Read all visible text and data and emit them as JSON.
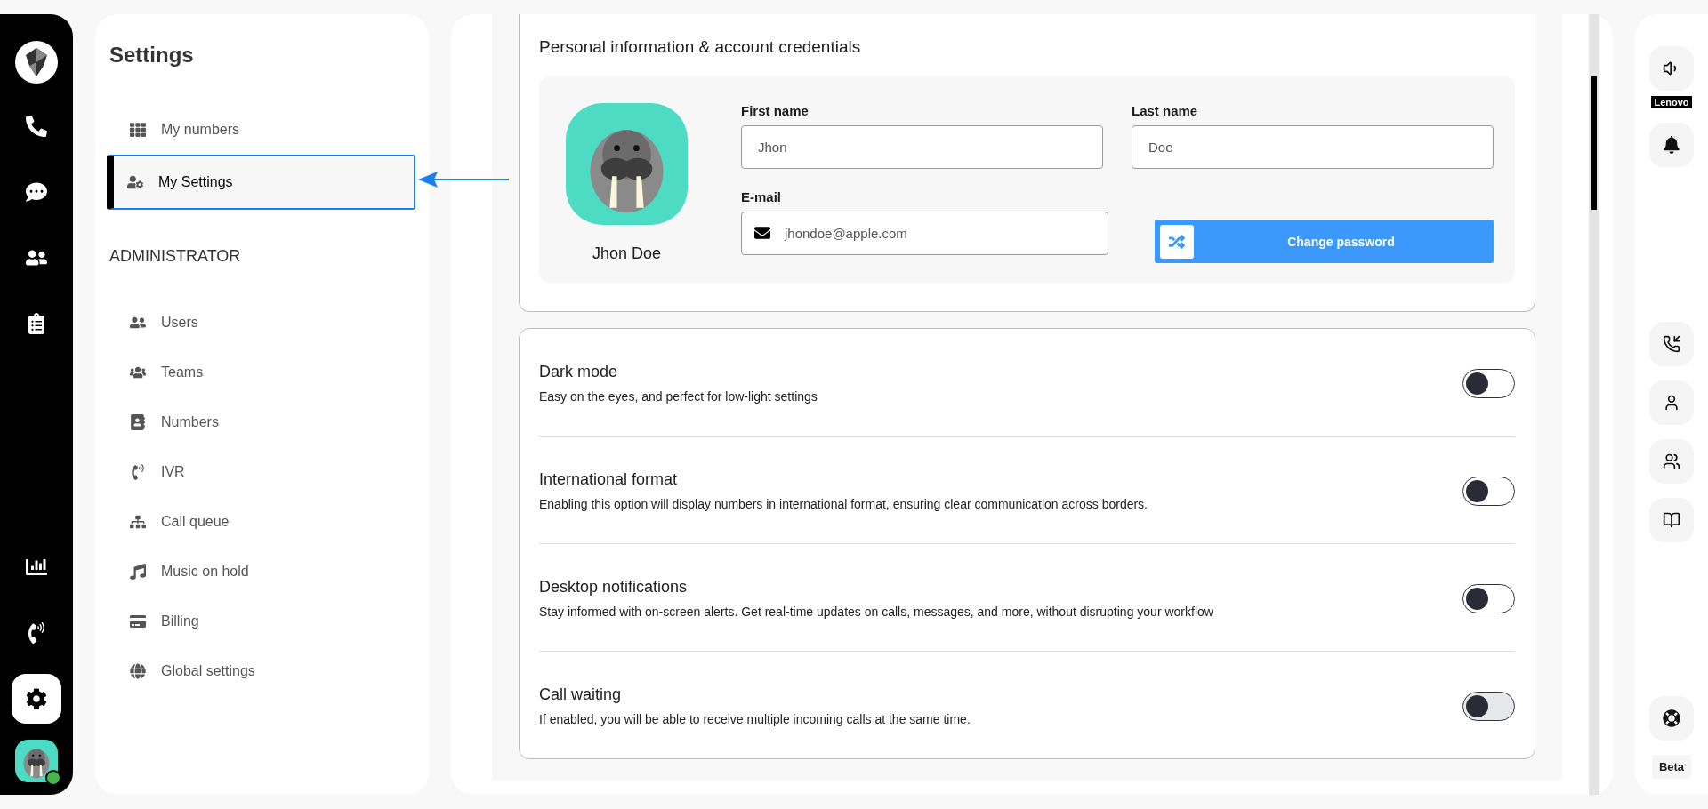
{
  "nav_rail": {
    "items": [
      {
        "selected": false
      },
      {
        "selected": false
      },
      {
        "selected": false
      },
      {
        "selected": false
      },
      {
        "selected": false
      },
      {
        "selected": false
      },
      {
        "selected": true
      }
    ]
  },
  "settings_panel": {
    "title": "Settings",
    "items": [
      {
        "label": "My numbers",
        "selected": false
      },
      {
        "label": "My Settings",
        "selected": true
      }
    ],
    "section": "ADMINISTRATOR",
    "admin_items": [
      {
        "label": "Users",
        "selected": false
      },
      {
        "label": "Teams",
        "selected": false
      },
      {
        "label": "Numbers",
        "selected": false
      },
      {
        "label": "IVR",
        "selected": false
      },
      {
        "label": "Call queue",
        "selected": false
      },
      {
        "label": "Music on hold",
        "selected": false
      },
      {
        "label": "Billing",
        "selected": false
      },
      {
        "label": "Global settings",
        "selected": false
      }
    ]
  },
  "profile": {
    "title": "Personal information & account credentials",
    "name": "Jhon Doe",
    "fields": [
      {
        "label": "First name",
        "value": "Jhon"
      },
      {
        "label": "Last name",
        "value": "Doe"
      },
      {
        "label": "E-mail",
        "value": "jhondoe@apple.com"
      }
    ],
    "button": "Change password"
  },
  "preferences": [
    {
      "title": "Dark mode",
      "description": "Easy on the eyes, and perfect for low-light settings",
      "on": false,
      "disabled": false
    },
    {
      "title": "International format",
      "description": "Enabling this option will display numbers in international format, ensuring clear communication across borders.",
      "on": false,
      "disabled": false
    },
    {
      "title": "Desktop notifications",
      "description": "Stay informed with on-screen alerts. Get real-time updates on calls, messages, and more, without disrupting your workflow",
      "on": false,
      "disabled": false
    },
    {
      "title": "Call waiting",
      "description": "If enabled, you will be able to receive multiple incoming calls at the same time.",
      "on": false,
      "disabled": true
    }
  ],
  "right_rail": {
    "device_label": "Lenovo",
    "badge": "Beta"
  }
}
